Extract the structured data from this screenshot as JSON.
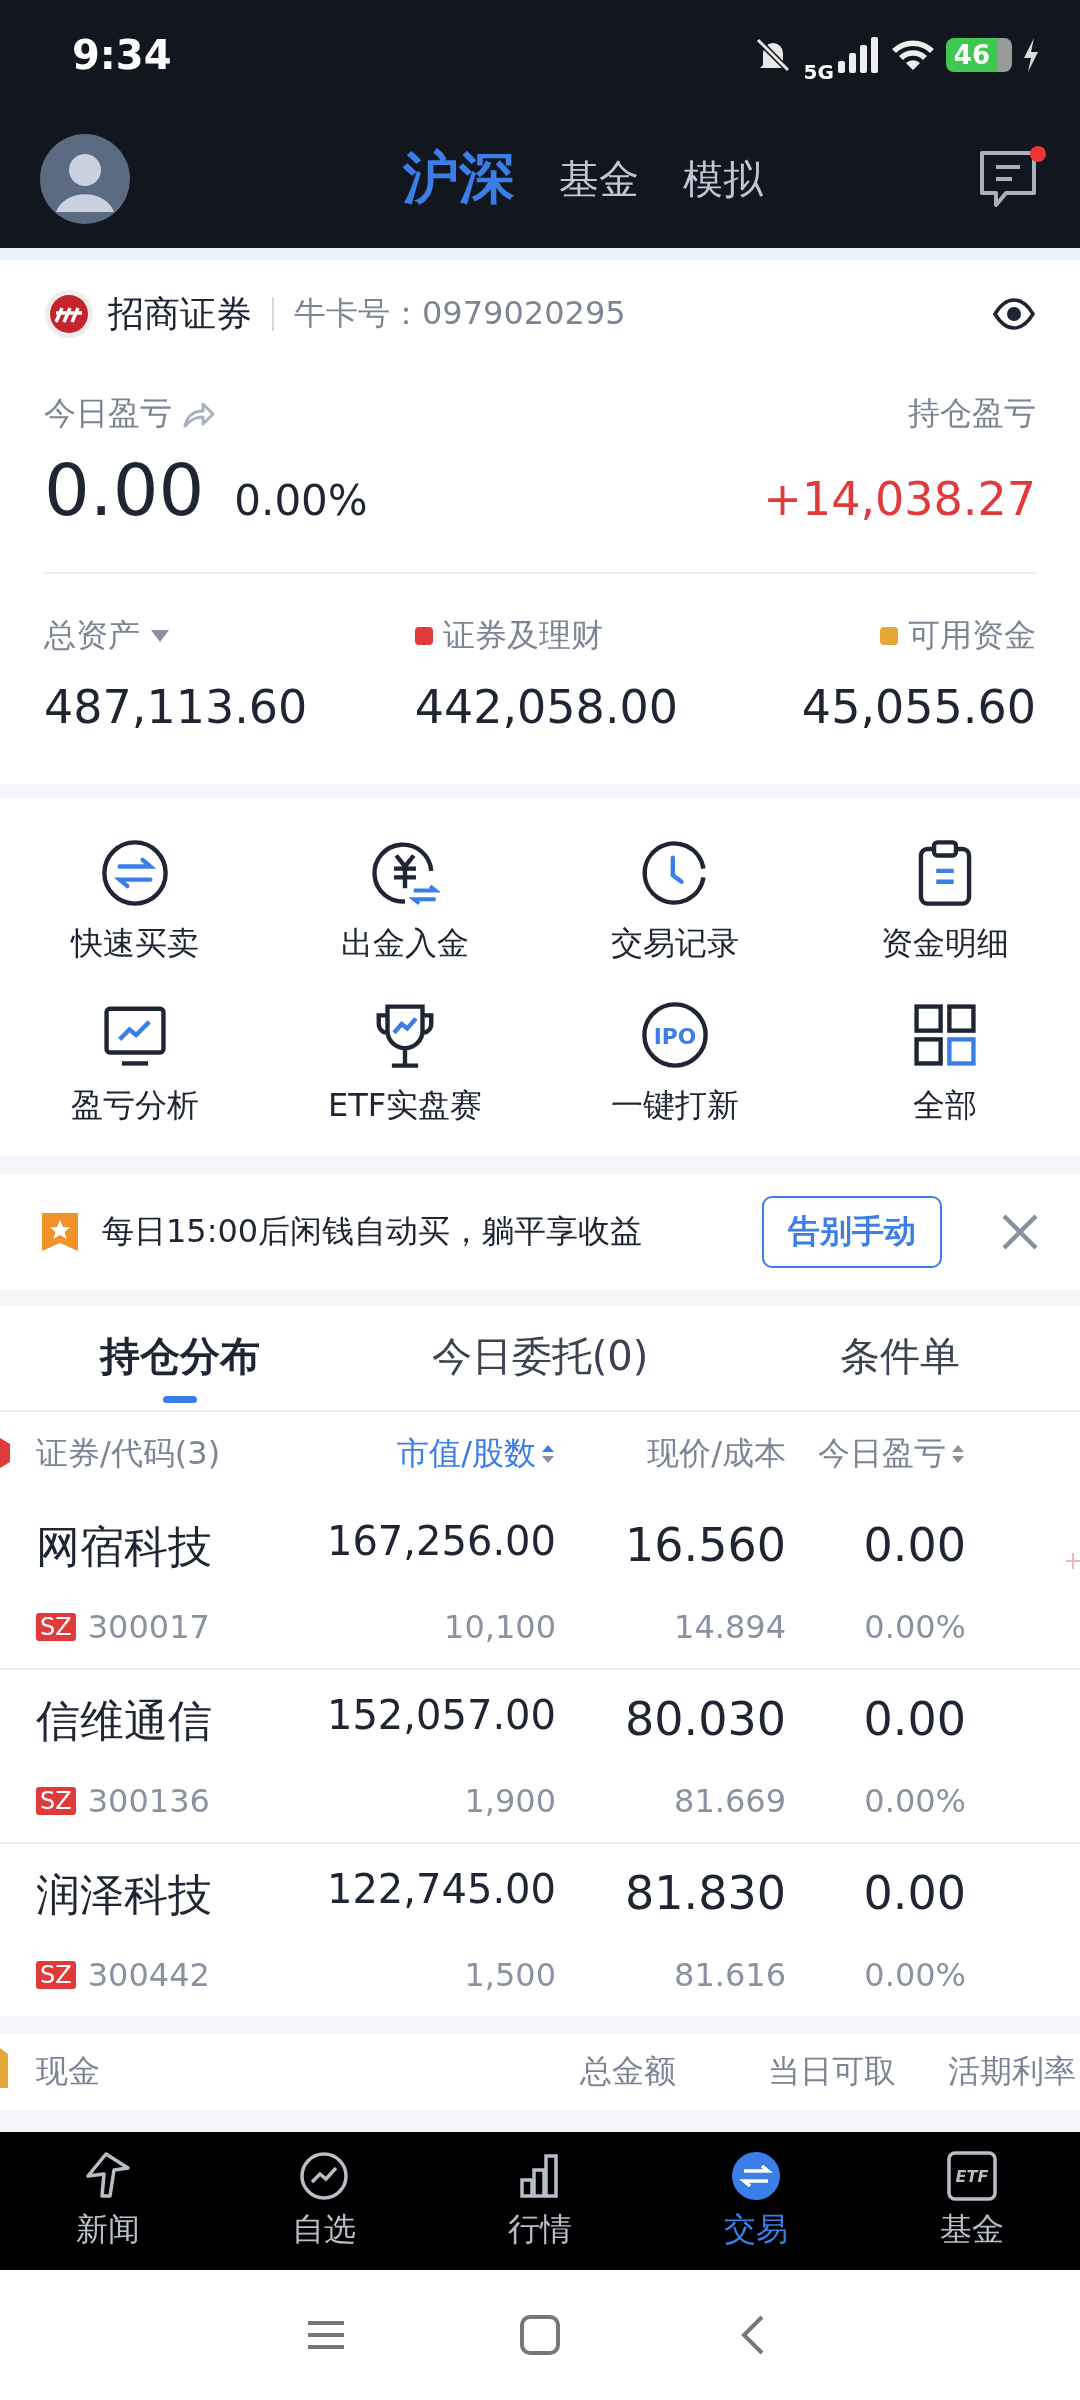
{
  "status_bar": {
    "time": "9:34",
    "network": "5G",
    "battery": "46"
  },
  "header": {
    "tabs": [
      {
        "label": "沪深",
        "selected": true
      },
      {
        "label": "基金",
        "selected": false
      },
      {
        "label": "模拟",
        "selected": false
      }
    ],
    "has_unread": true
  },
  "account": {
    "broker": "招商证券",
    "card_label": "牛卡号：",
    "card_number": "0979020295",
    "today_pl_label": "今日盈亏",
    "today_pl": "0.00",
    "today_pl_pct": "0.00%",
    "hold_pl_label": "持仓盈亏",
    "hold_pl": "+14,038.27",
    "assets": [
      {
        "label": "总资产",
        "value": "487,113.60"
      },
      {
        "label": "证券及理财",
        "value": "442,058.00",
        "color": "#e03a3a"
      },
      {
        "label": "可用资金",
        "value": "45,055.60",
        "color": "#e5a838"
      }
    ]
  },
  "shortcuts": [
    {
      "kind": "swap",
      "label": "快速买卖"
    },
    {
      "kind": "yuan",
      "label": "出金入金"
    },
    {
      "kind": "clock",
      "label": "交易记录"
    },
    {
      "kind": "clipboard",
      "label": "资金明细"
    },
    {
      "kind": "monitor",
      "label": "盈亏分析"
    },
    {
      "kind": "trophy",
      "label": "ETF实盘赛"
    },
    {
      "kind": "ipo",
      "label": "一键打新",
      "icon_text": "IPO"
    },
    {
      "kind": "grid",
      "label": "全部"
    }
  ],
  "banner": {
    "text": "每日15:00后闲钱自动买，躺平享收益",
    "button": "告别手动"
  },
  "position_tabs": [
    {
      "label": "持仓分布",
      "selected": true
    },
    {
      "label": "今日委托(0)",
      "selected": false
    },
    {
      "label": "条件单",
      "selected": false
    }
  ],
  "columns": [
    {
      "label": "证券/代码(3)",
      "selected": false,
      "sortable": false
    },
    {
      "label": "市值/股数",
      "selected": true,
      "sortable": true
    },
    {
      "label": "现价/成本",
      "selected": false,
      "sortable": false
    },
    {
      "label": "今日盈亏",
      "selected": false,
      "sortable": true
    }
  ],
  "positions": [
    {
      "name": "网宿科技",
      "market": "SZ",
      "code": "300017",
      "value": "167,256.00",
      "shares": "10,100",
      "price": "16.560",
      "cost": "14.894",
      "pl": "0.00",
      "pl_pct": "0.00%"
    },
    {
      "name": "信维通信",
      "market": "SZ",
      "code": "300136",
      "value": "152,057.00",
      "shares": "1,900",
      "price": "80.030",
      "cost": "81.669",
      "pl": "0.00",
      "pl_pct": "0.00%"
    },
    {
      "name": "润泽科技",
      "market": "SZ",
      "code": "300442",
      "value": "122,745.00",
      "shares": "1,500",
      "price": "81.830",
      "cost": "81.616",
      "pl": "0.00",
      "pl_pct": "0.00%"
    }
  ],
  "cash_header": [
    "现金",
    "总金额",
    "当日可取",
    "活期利率"
  ],
  "bottom_nav": [
    {
      "kind": "news",
      "label": "新闻",
      "selected": false
    },
    {
      "kind": "watch",
      "label": "自选",
      "selected": false
    },
    {
      "kind": "market",
      "label": "行情",
      "selected": false
    },
    {
      "kind": "trade",
      "label": "交易",
      "selected": true
    },
    {
      "kind": "fund",
      "label": "基金",
      "selected": false,
      "icon_text": "ETF"
    }
  ]
}
